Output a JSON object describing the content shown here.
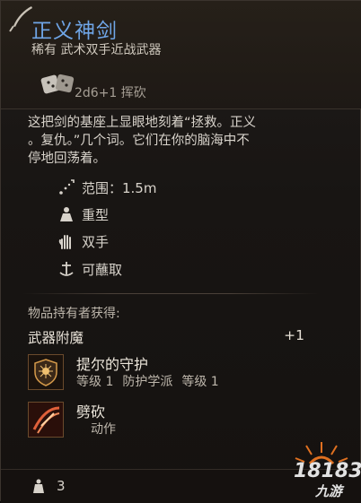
{
  "item": {
    "name": "正义神剑",
    "subtitle": "稀有 武术双手近战武器",
    "damage": "2d6+1 挥砍",
    "description": "这把剑的基座上显眼地刻着“拯救。正义。复仇。”几个词。它们在你的脑海中不停地回荡着。",
    "description_lines": [
      "这把剑的基座上显眼地刻着“拯救。正义",
      "。复仇。”几个词。它们在你的脑海中不",
      "停地回荡着。"
    ],
    "properties": [
      {
        "icon": "range-icon",
        "label": "范围：1.5m"
      },
      {
        "icon": "heavy-icon",
        "label": "重型"
      },
      {
        "icon": "two-handed-icon",
        "label": "双手"
      },
      {
        "icon": "dippable-icon",
        "label": "可蘸取"
      }
    ]
  },
  "wielder": {
    "label": "物品持有者获得:",
    "enchant_label": "武器附魔",
    "enchant_value": "+1",
    "abilities": [
      {
        "icon": "shield-sun-icon",
        "name": "提尔的守护",
        "level": "等级 1",
        "school": "防护学派",
        "level2": "等级 1"
      },
      {
        "icon": "cleave-icon",
        "name": "劈砍",
        "type": "动作"
      }
    ]
  },
  "footer": {
    "weight_icon": "weight-icon",
    "weight": "3"
  },
  "watermark": {
    "line1": "18183",
    "line2": "九游"
  },
  "colors": {
    "title": "#6fa5e6",
    "border": "#3b342e"
  }
}
